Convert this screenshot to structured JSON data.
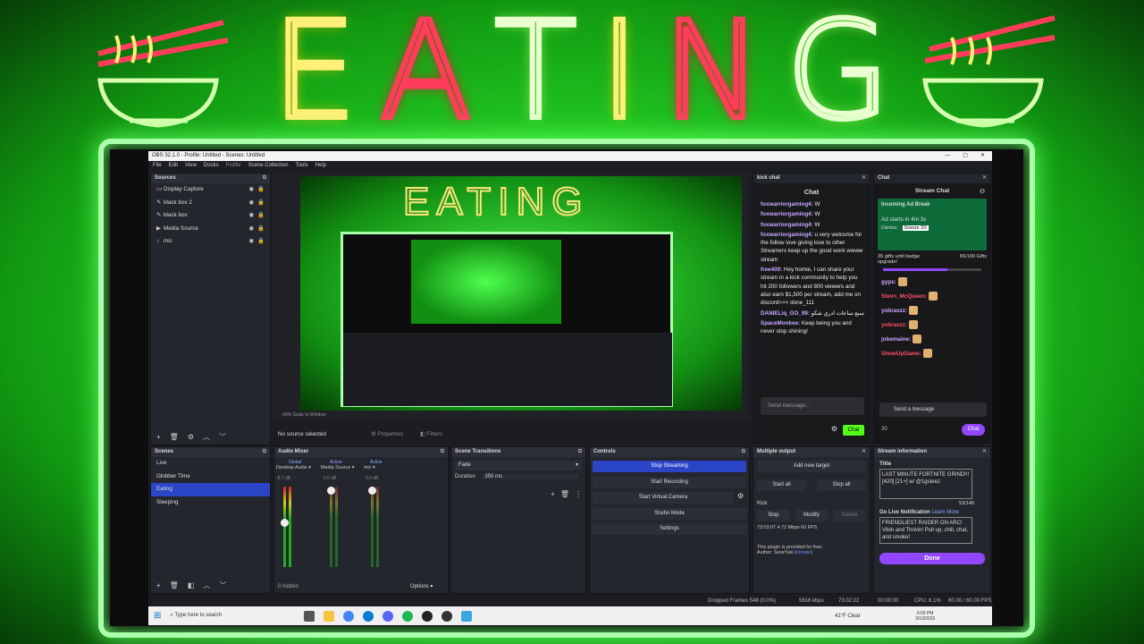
{
  "overlay": {
    "title_letters": [
      "E",
      "A",
      "T",
      "I",
      "N",
      "G"
    ],
    "letter_colors": [
      "#fff07a",
      "#ff3d5a",
      "#d8ffb0",
      "#fff07a",
      "#ff3d5a",
      "#d8ffb0"
    ]
  },
  "window": {
    "title": "OBS 32.1.0 - Profile: Untitled - Scenes: Untitled"
  },
  "menu": [
    "File",
    "Edit",
    "View",
    "Docks",
    "Profile",
    "Scene Collection",
    "Tools",
    "Help"
  ],
  "sources": {
    "header": "Sources",
    "items": [
      {
        "icon": "monitor-icon",
        "glyph": "▭",
        "label": "Display Capture"
      },
      {
        "icon": "brush-icon",
        "glyph": "✎",
        "label": "black box 2"
      },
      {
        "icon": "brush-icon",
        "glyph": "✎",
        "label": "black box"
      },
      {
        "icon": "play-icon",
        "glyph": "▶",
        "label": "Media Source"
      },
      {
        "icon": "mic-icon",
        "glyph": "♪",
        "label": "mic"
      }
    ]
  },
  "preview_toolbar": {
    "zoom": "- 49%",
    "scale": "Scale to Window"
  },
  "context_bar": {
    "no_source": "No source selected",
    "properties": "Properties",
    "filters": "Filters"
  },
  "scenes": {
    "header": "Scenes",
    "items": [
      "Live",
      "Globber Time",
      "Eating",
      "Sleeping"
    ],
    "selected": "Eating"
  },
  "audio_mixer": {
    "header": "Audio Mixer",
    "global": "Global",
    "channels": [
      {
        "name": "Desktop Audio",
        "db": "-8.7 dB",
        "active": ""
      },
      {
        "name": "Media Source",
        "db": "0.0 dB",
        "active": "Active"
      },
      {
        "name": "mic",
        "db": "0.0 dB",
        "active": "Active"
      }
    ],
    "hidden": "0 hidden",
    "options": "Options"
  },
  "transitions": {
    "header": "Scene Transitions",
    "type": "Fade",
    "duration_label": "Duration",
    "duration": "350 ms"
  },
  "controls": {
    "header": "Controls",
    "buttons": [
      "Stop Streaming",
      "Start Recording",
      "Start Virtual Camera",
      "Studio Mode",
      "Settings"
    ]
  },
  "multi_output": {
    "header": "Multiple output",
    "add": "Add new target",
    "start_all": "Start all",
    "stop_all": "Stop all",
    "target": "Kick",
    "stop": "Stop",
    "modify": "Modify",
    "delete": "Delete",
    "stats": "73:03:07  4.72 Mbps  60 FPS",
    "free": "This plugin is provided for free.",
    "author": "Author: SoraYuki",
    "donate": "donate"
  },
  "kick_chat": {
    "header": "kick chat",
    "title": "Chat",
    "messages": [
      {
        "user": "foxwarriorgaming4:",
        "text": "W",
        "tag": "1"
      },
      {
        "user": "foxwarriorgaming4:",
        "text": "W",
        "tag": "2"
      },
      {
        "user": "foxwarriorgaming4:",
        "text": "W",
        "tag": "3"
      },
      {
        "user": "foxwarriorgaming4:",
        "text": "u very welcome for the follow love giving love to other Streamers keep up the good work wwww stream",
        "tag": "4"
      },
      {
        "user": "free409:",
        "text": "Hey homie, I can share your stream in a kick community to help you hit 200 followers and 800 viewers and also earn $1,500 per stream, add me on discord>>> done_111",
        "tag": "5"
      },
      {
        "user": "DANIELiq_GO_99:",
        "text": "سبع ساعات ادري شكو",
        "tag": "6"
      },
      {
        "user": "SpaceMonkee:",
        "text": "Keep being you and never stop shining!",
        "tag": "7"
      }
    ],
    "placeholder": "Send message...",
    "send": "Chat"
  },
  "twitch_chat": {
    "header": "Chat",
    "title": "Stream Chat",
    "ad_title": "Incoming Ad Break",
    "ad_time": "Ad starts in 4m 3s",
    "dismiss": "Dismiss",
    "snooze": "Snooze 3/3",
    "gifts": "35 gifts until badge upgrade!",
    "gifts_count": "65/100 Gifts",
    "users": [
      "gyps:",
      "Stevn_McQueen:",
      "yobraxzz:",
      "yobraxzz:",
      "jobemaine:",
      "ShowUpGame:"
    ],
    "placeholder": "Send a message",
    "send": "Chat",
    "points": "30"
  },
  "stream_info": {
    "header": "Stream information",
    "title_label": "Title",
    "title": "LAST MINUTE FORTNITE GRIND!!! [420] [21+] w/ @1gsteez",
    "count": "53/140",
    "golive_label": "Go Live Notification",
    "learn": "Learn More",
    "golive": "FRIENDLIEST RAIDER ON ARC! Vibin and Thrivin! Pull up, chill, chat, and smoke!",
    "done": "Done"
  },
  "status_bar": {
    "dropped": "Dropped Frames 548 (0.0%)",
    "kbps": "5616 kbps",
    "time1": "73:02:22",
    "time2": "00:00:00",
    "cpu": "CPU: 6.1%",
    "fps": "60.00 / 60.00 FPS"
  },
  "taskbar": {
    "search": "Type here to search",
    "weather": "41°F  Clear",
    "time": "9:00 PM",
    "date": "3/19/2026"
  },
  "colors": {
    "obs_bg": "#1b1d22",
    "accent_blue": "#2a45c6",
    "twitch_purple": "#9147ff",
    "neon_green": "#5eff5e"
  }
}
